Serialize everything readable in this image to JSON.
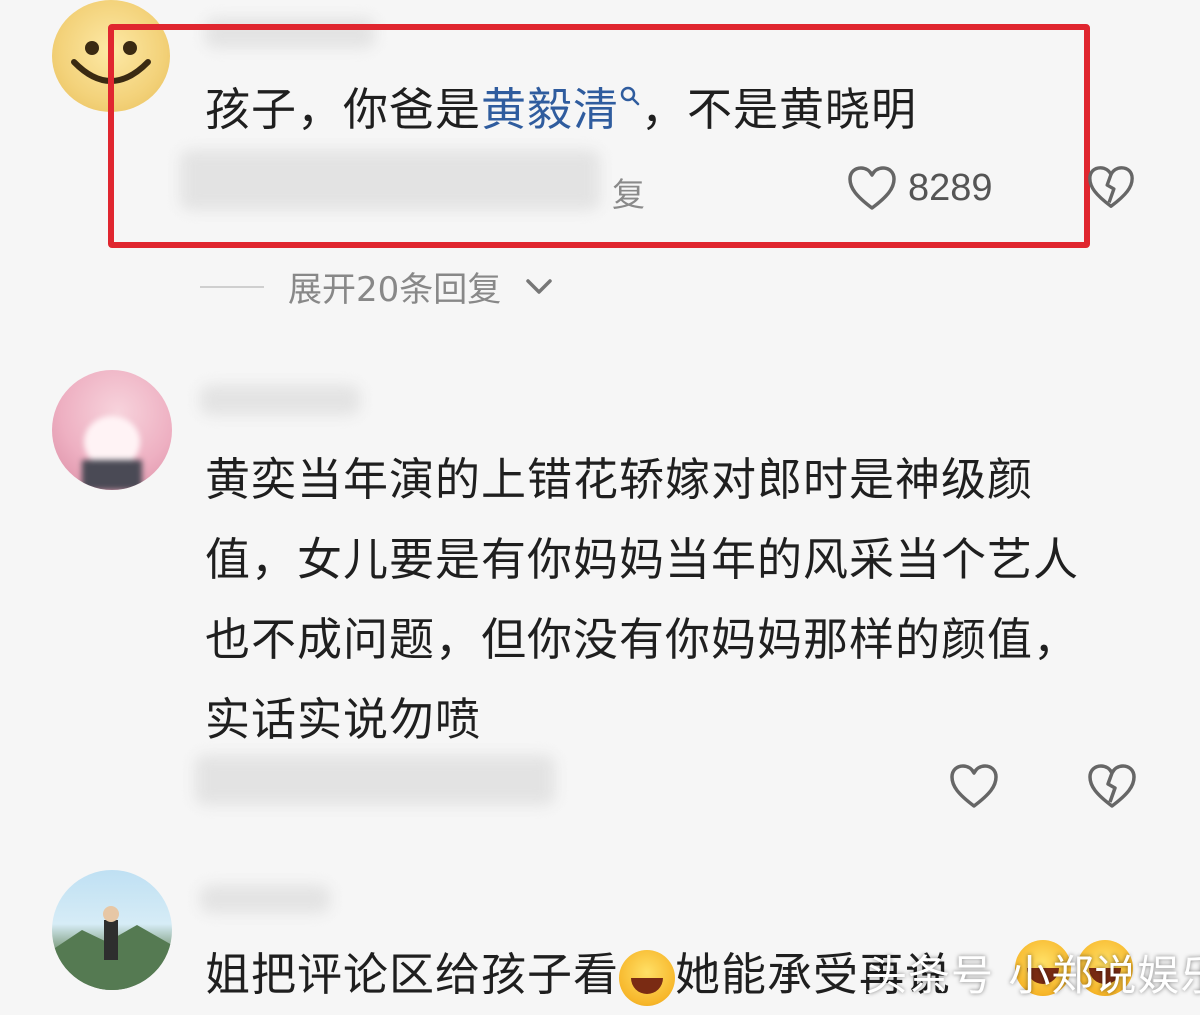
{
  "comment1": {
    "text_before_link": "孩子，你爸是",
    "link_text": "黄毅清",
    "text_after_link": "，不是黄晓明",
    "reply_label": "复",
    "like_count": "8289",
    "expand_replies_label": "展开20条回复"
  },
  "comment2": {
    "text": "黄奕当年演的上错花轿嫁对郎时是神级颜值，女儿要是有你妈妈当年的风采当个艺人也不成问题，但你没有你妈妈那样的颜值，实话实说勿喷"
  },
  "comment3": {
    "text_before_emoji": "姐把评论区给孩子看",
    "text_after_emoji": "她能承受再说"
  },
  "watermark": {
    "text": "头条号 小郑说娱乐"
  },
  "colors": {
    "highlight_border": "#e0262f",
    "link": "#2f5c9e",
    "background": "#f6f6f6"
  }
}
